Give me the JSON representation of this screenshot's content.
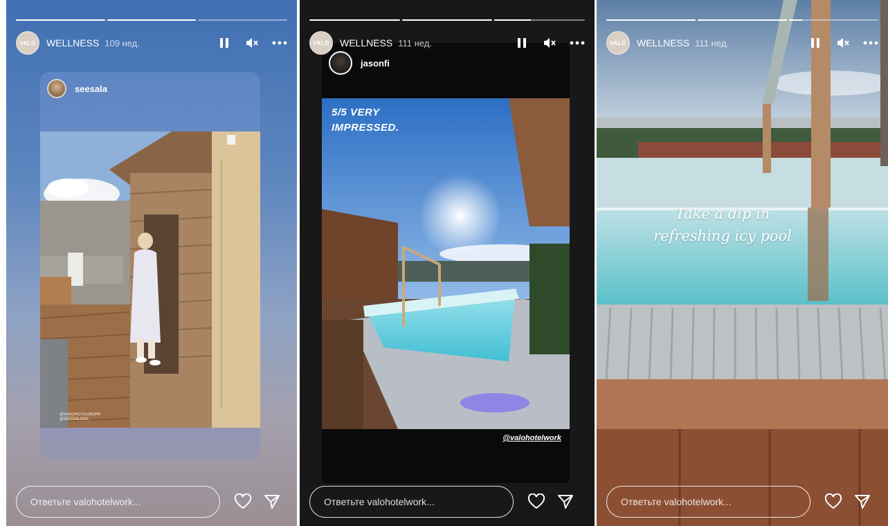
{
  "stories": [
    {
      "account": "WELLNESS",
      "avatar_text": "VALO",
      "age": "109 нед.",
      "progress": [
        1,
        1,
        0.0
      ],
      "reposted_user": "seesala",
      "photo_credit_lines": [
        "@VALOHOTELWORK",
        "@SEESALANA"
      ],
      "reply_placeholder": "Ответьте valohotelwork..."
    },
    {
      "account": "WELLNESS",
      "avatar_text": "VALO",
      "age": "111 нед.",
      "progress": [
        1,
        1,
        0.4
      ],
      "reposted_user": "jasonfi",
      "quote_lines": [
        "5/5 VERY",
        "IMPRESSED."
      ],
      "handle": "@valohotelwork",
      "reply_placeholder": "Ответьте valohotelwork..."
    },
    {
      "account": "WELLNESS",
      "avatar_text": "VALO",
      "age": "111 нед.",
      "progress": [
        1,
        1,
        0.15
      ],
      "caption_lines": [
        "Take a dip in",
        "refreshing icy pool"
      ],
      "reply_placeholder": "Ответьте valohotelwork..."
    }
  ],
  "icons": {
    "pause": "pause-icon",
    "mute": "speaker-muted-icon",
    "more": "more-dots-icon",
    "like": "heart-icon",
    "send": "send-icon"
  },
  "colors": {
    "story1_bg_top": "#3f6fb2",
    "story2_bg": "#181818",
    "text": "#ffffff"
  }
}
